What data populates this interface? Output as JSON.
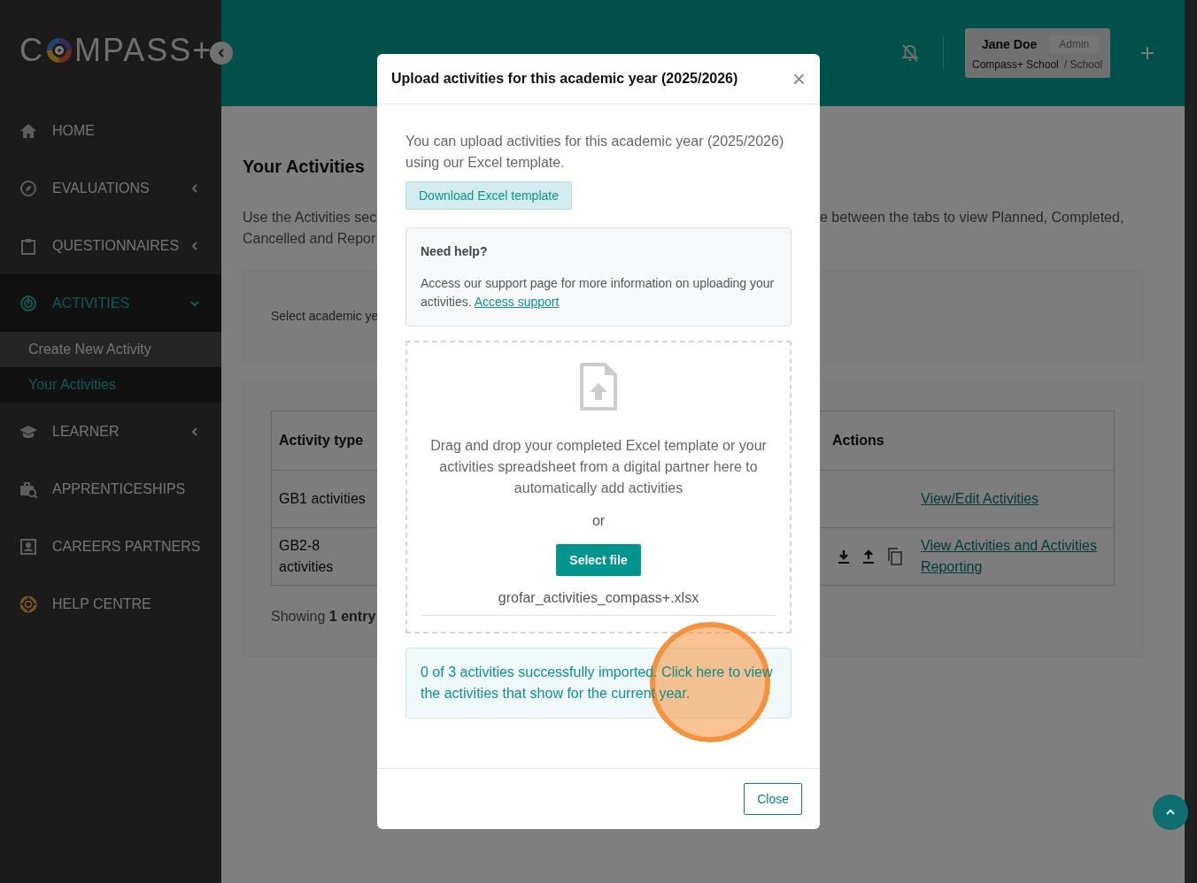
{
  "logo": {
    "start": "C",
    "end": "MPASS+"
  },
  "sidebar": {
    "items": [
      {
        "label": "HOME",
        "selected": false
      },
      {
        "label": "EVALUATIONS",
        "selected": false,
        "expanded": false
      },
      {
        "label": "QUESTIONNAIRES",
        "selected": false,
        "expanded": false
      },
      {
        "label": "ACTIVITIES",
        "selected": true,
        "expanded": true,
        "children": [
          {
            "label": "Create New Activity",
            "selected": false
          },
          {
            "label": "Your Activities",
            "selected": true
          }
        ]
      },
      {
        "label": "LEARNER",
        "selected": false,
        "expanded": false
      },
      {
        "label": "APPRENTICESHIPS",
        "selected": false
      },
      {
        "label": "CAREERS PARTNERS",
        "selected": false
      },
      {
        "label": "HELP CENTRE",
        "selected": false
      }
    ]
  },
  "header": {
    "user": {
      "name": "Jane Doe",
      "role": "Admin",
      "school": "Compass+ School",
      "school_type": "/ School"
    }
  },
  "page": {
    "title": "Your Activities",
    "description_left": [
      "Use the Activities sec",
      "Cancelled and Repor"
    ],
    "description_right": "e between the tabs to view Planned, Completed,",
    "select_label": "Select academic ye",
    "table": {
      "columns": [
        "Activity type",
        "Actions"
      ],
      "rows": [
        {
          "activity_type": "GB1 activities",
          "action_icons": false,
          "action": "View/Edit Activities"
        },
        {
          "activity_type": "GB2-8 activities",
          "action_icons": true,
          "action": "View Activities and Activities Reporting"
        }
      ]
    },
    "footer": "Showing **1 entry**"
  },
  "modal": {
    "title": "Upload activities for this academic year (2025/2026)",
    "close_icon": "×",
    "intro": "You can upload activities for this academic year (2025/2026) using our Excel template.",
    "download_button": "Download Excel template",
    "help": {
      "title": "Need help?",
      "text": "Access our support page for more information on uploading your activities.",
      "link": "Access support"
    },
    "dropzone": {
      "text": "Drag and drop your completed Excel template or your activities spreadsheet from a digital partner here to automatically add activities",
      "or": "or",
      "button": "Select file",
      "file": "grofar_activities_compass+.xlsx"
    },
    "result": "0 of 3 activities successfully imported. Click here to view the activities that show for the current year.",
    "close_button": "Close"
  }
}
